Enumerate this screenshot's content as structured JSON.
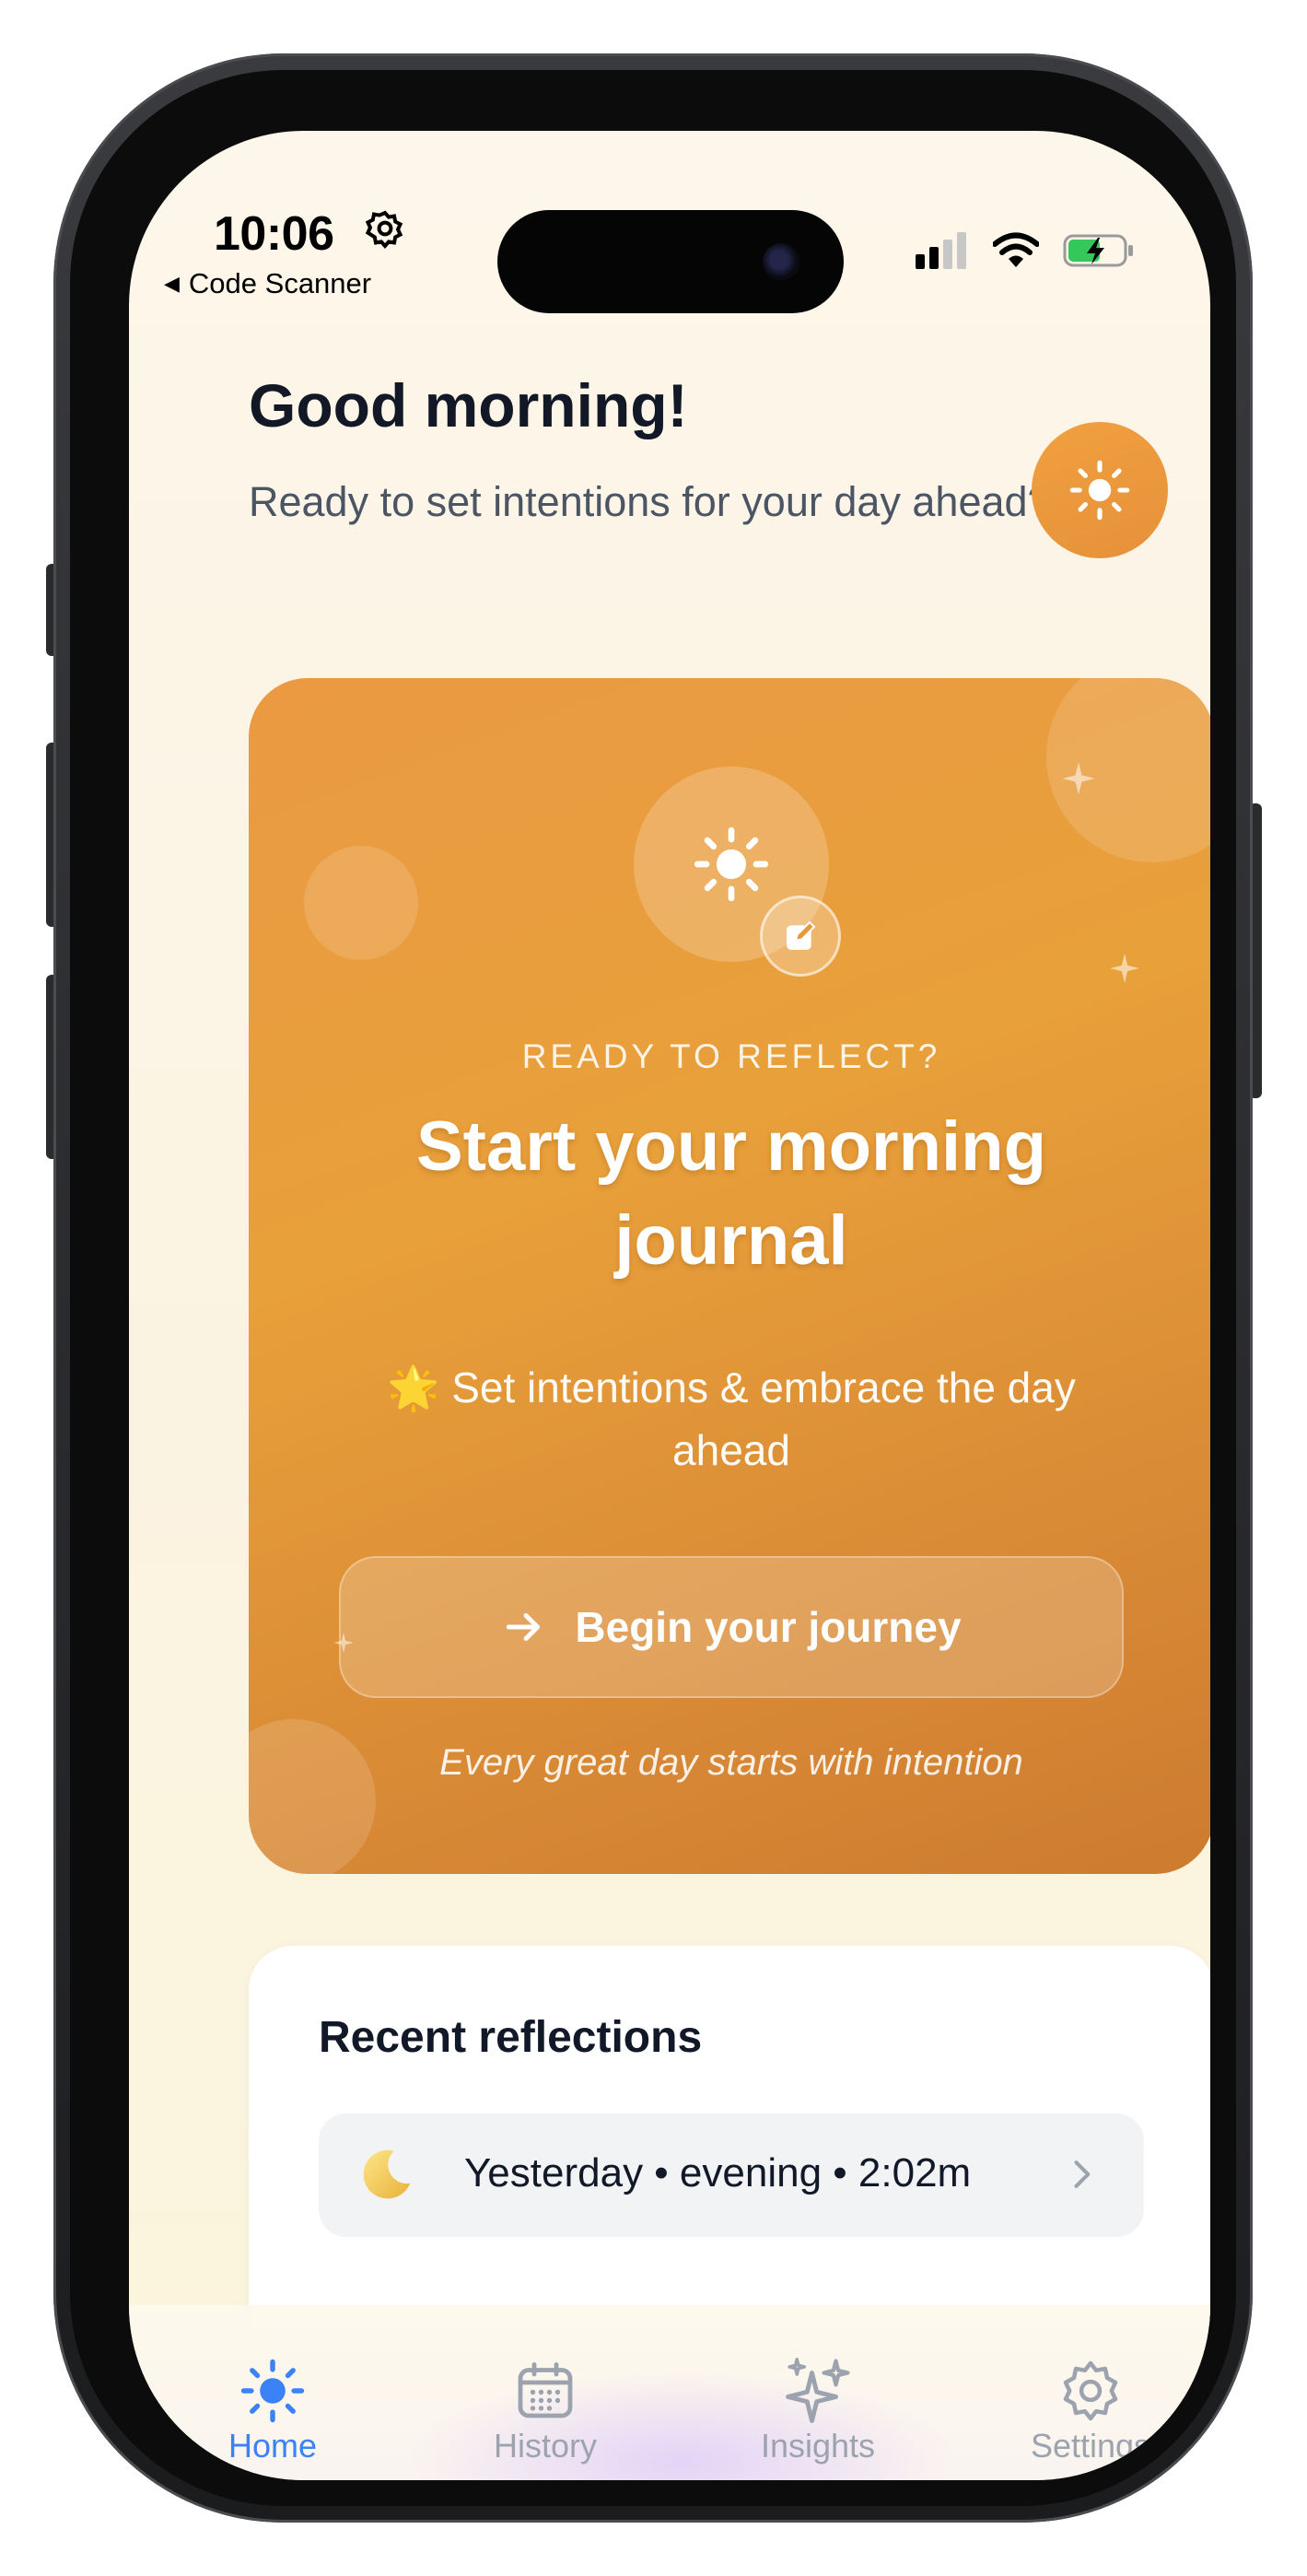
{
  "status_bar": {
    "time": "10:06",
    "back_app": "Code Scanner"
  },
  "header": {
    "greeting": "Good morning!",
    "subtitle": "Ready to set intentions for your day ahead?",
    "icon": "sun-icon"
  },
  "hero": {
    "eyebrow": "READY TO REFLECT?",
    "title": "Start your morning journal",
    "subtitle_emoji": "🌟",
    "subtitle": "Set intentions & embrace the day ahead",
    "cta_label": "Begin your journey",
    "note": "Every great day starts with intention",
    "accent": "#E99A3E"
  },
  "recent": {
    "title": "Recent reflections",
    "items": [
      {
        "icon": "moon-icon",
        "label": "Yesterday • evening • 2:02m"
      }
    ]
  },
  "tabs": [
    {
      "label": "Home",
      "icon": "sun-icon",
      "active": true
    },
    {
      "label": "History",
      "icon": "calendar-icon",
      "active": false
    },
    {
      "label": "Insights",
      "icon": "sparkles-icon",
      "active": false
    },
    {
      "label": "Settings",
      "icon": "gear-icon",
      "active": false
    }
  ],
  "colors": {
    "active_tab": "#3B82F6",
    "inactive_tab": "#9CA3AF"
  }
}
